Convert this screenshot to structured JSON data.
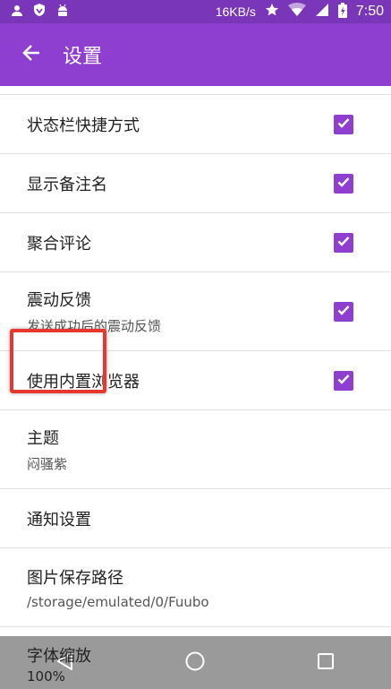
{
  "status_bar": {
    "net_speed": "16KB/s",
    "time": "7:50"
  },
  "toolbar": {
    "title": "设置"
  },
  "settings": [
    {
      "label": "状态栏快捷方式",
      "checked": true
    },
    {
      "label": "显示备注名",
      "checked": true
    },
    {
      "label": "聚合评论",
      "checked": true
    },
    {
      "label": "震动反馈",
      "sub": "发送成功后的震动反馈",
      "checked": true
    },
    {
      "label": "使用内置浏览器",
      "checked": true
    },
    {
      "label": "主题",
      "sub": "闷骚紫"
    },
    {
      "label": "通知设置"
    },
    {
      "label": "图片保存路径",
      "sub": "/storage/emulated/0/Fuubo"
    },
    {
      "label": "字体缩放",
      "sub": "100%"
    }
  ],
  "colors": {
    "accent": "#8e3fd0",
    "status_bar": "#7a36b8",
    "highlight": "#e8372e"
  }
}
